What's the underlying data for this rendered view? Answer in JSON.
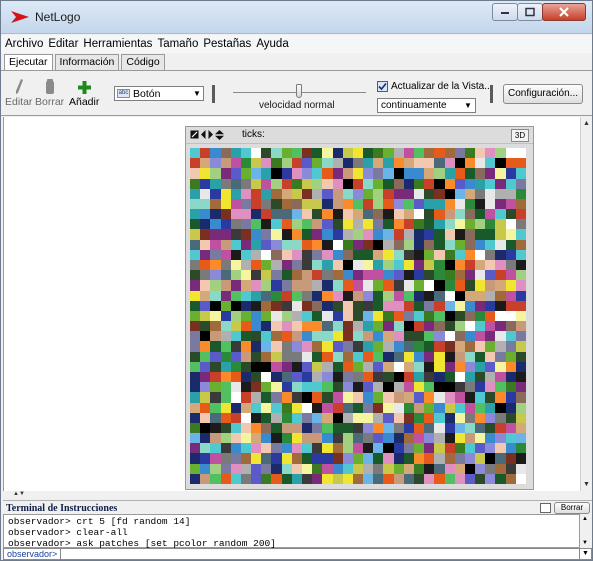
{
  "window": {
    "title": "NetLogo"
  },
  "menu": [
    "Archivo",
    "Editar",
    "Herramientas",
    "Tamaño",
    "Pestañas",
    "Ayuda"
  ],
  "tabs": [
    {
      "label": "Ejecutar",
      "active": true
    },
    {
      "label": "Información",
      "active": false
    },
    {
      "label": "Código",
      "active": false
    }
  ],
  "toolbar": {
    "edit_label": "Editar",
    "delete_label": "Borrar",
    "add_label": "Añadir",
    "widget_type": "Botón",
    "speed_label": "velocidad normal",
    "speed_value": 0.5,
    "update_view_label": "Actualizar de la Vista...",
    "update_view_checked": true,
    "update_mode": "continuamente",
    "settings_label": "Configuración..."
  },
  "view": {
    "ticks_label": "ticks:",
    "ticks_value": "",
    "three_d_label": "3D",
    "patch_grid_size": 33,
    "palette": [
      "#000000",
      "#1b1b1b",
      "#3a3a3a",
      "#7a7a7a",
      "#b0b0b0",
      "#e8e8e8",
      "#ffffff",
      "#f5f5a0",
      "#f0e630",
      "#c8c84a",
      "#fa8a2a",
      "#e65a1a",
      "#c8402a",
      "#7a3020",
      "#a06a3a",
      "#d4a878",
      "#f2c8b0",
      "#e090c0",
      "#c050a0",
      "#7a2a7a",
      "#8a8ad8",
      "#5a5ac8",
      "#2a3aa0",
      "#1a2a6a",
      "#6ab4e8",
      "#3a8ad0",
      "#50c8d0",
      "#2aa0a8",
      "#8ad8c8",
      "#50c060",
      "#2a8a3a",
      "#1a5a2a",
      "#a0d080",
      "#6ab030",
      "#3a7a20",
      "#2a4a2a",
      "#7a7aa0",
      "#4a6a7a",
      "#c89a7a",
      "#8a6a5a"
    ]
  },
  "command_center": {
    "title": "Terminal de Instrucciones",
    "clear_label": "Borrar",
    "lines": [
      "observador> crt 5 [fd random 14]",
      "observador> clear-all",
      "observador> ask patches [set pcolor random 200]"
    ],
    "agent_label": "observador>",
    "input_value": ""
  },
  "icons": {
    "app": "netlogo-logo-icon",
    "edit": "pencil-icon",
    "delete": "trash-icon",
    "add": "plus-icon"
  }
}
